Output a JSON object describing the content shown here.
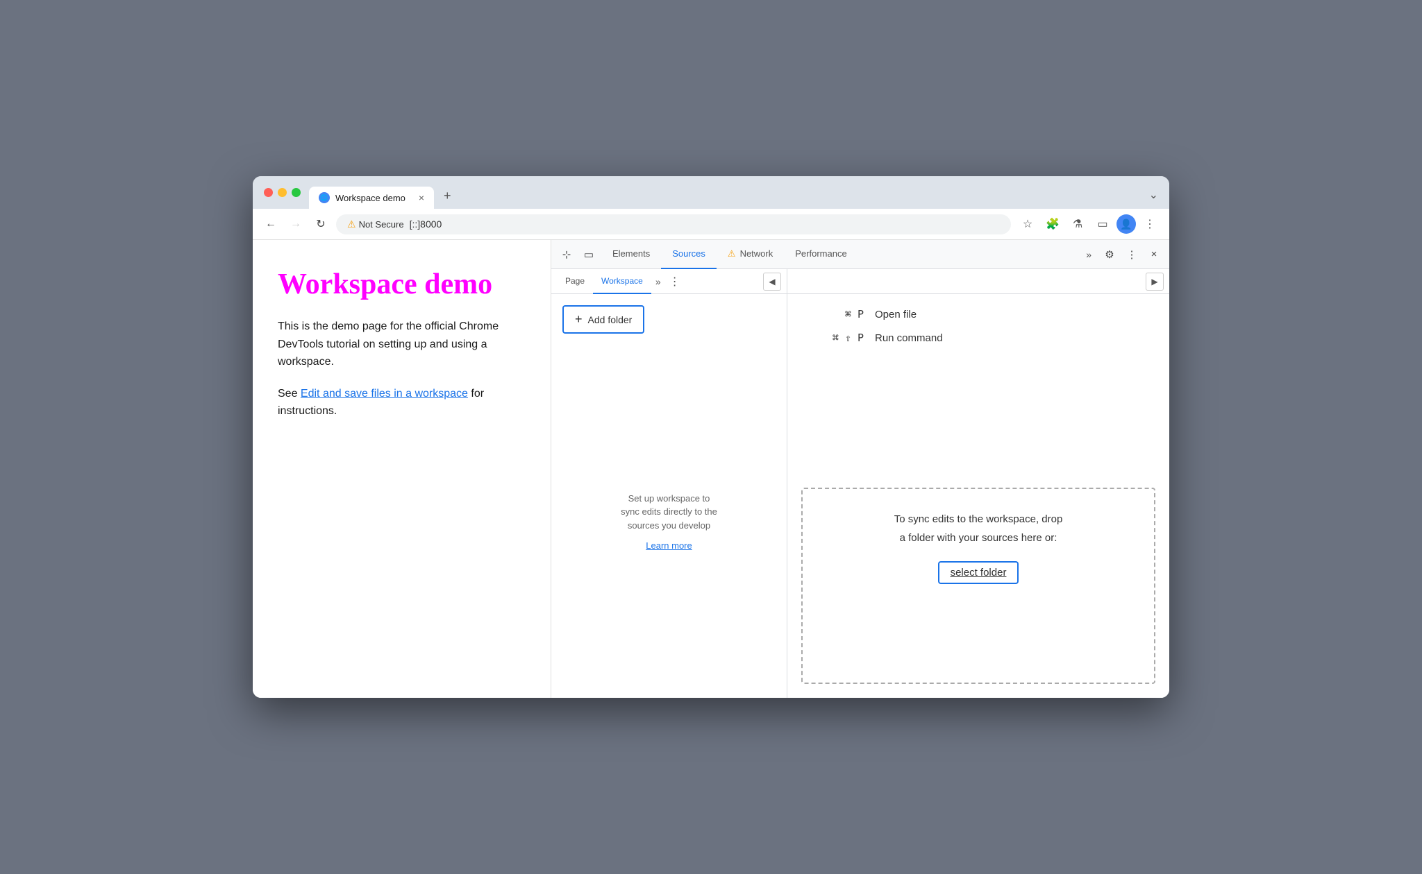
{
  "browser": {
    "tab": {
      "title": "Workspace demo",
      "favicon": "🌐",
      "close_label": "×"
    },
    "new_tab_label": "+",
    "tab_more_label": "⌄",
    "nav": {
      "back_label": "←",
      "forward_label": "→",
      "refresh_label": "↻",
      "security_label": "Not Secure",
      "address": "[::]8000",
      "bookmark_icon": "☆",
      "extensions_icon": "🧩",
      "devtools_icon": "⚗",
      "sidebar_icon": "⬛",
      "profile_icon": "👤",
      "menu_icon": "⋮"
    }
  },
  "webpage": {
    "title": "Workspace demo",
    "paragraph1": "This is the demo page for the official Chrome DevTools tutorial on setting up and using a workspace.",
    "paragraph2_before": "See ",
    "link_text": "Edit and save files in a workspace",
    "paragraph2_after": " for instructions."
  },
  "devtools": {
    "toolbar": {
      "inspect_icon": "⊞",
      "device_icon": "⬡",
      "tabs": [
        {
          "label": "Elements",
          "active": false
        },
        {
          "label": "Sources",
          "active": true
        },
        {
          "label": "Network",
          "active": false,
          "warning": true
        },
        {
          "label": "Performance",
          "active": false
        }
      ],
      "more_label": "»",
      "settings_icon": "⚙",
      "menu_icon": "⋮",
      "close_icon": "×"
    },
    "sources": {
      "sidebar_tabs": [
        {
          "label": "Page",
          "active": false
        },
        {
          "label": "Workspace",
          "active": true
        }
      ],
      "more_label": "»",
      "menu_icon": "⋮",
      "collapse_icon": "◀",
      "collapse_right_icon": "▶",
      "add_folder_label": "Add folder",
      "workspace_message": {
        "line1": "Set up workspace to",
        "line2": "sync edits directly to the",
        "line3": "sources you develop",
        "learn_more": "Learn more"
      },
      "editor": {
        "shortcut1_keys": "⌘ P",
        "shortcut1_label": "Open file",
        "shortcut2_keys": "⌘ ⇧ P",
        "shortcut2_label": "Run command"
      },
      "drop_zone": {
        "text1": "To sync edits to the workspace, drop",
        "text2": "a folder with your sources here or:",
        "select_folder_label": "select folder"
      }
    }
  }
}
